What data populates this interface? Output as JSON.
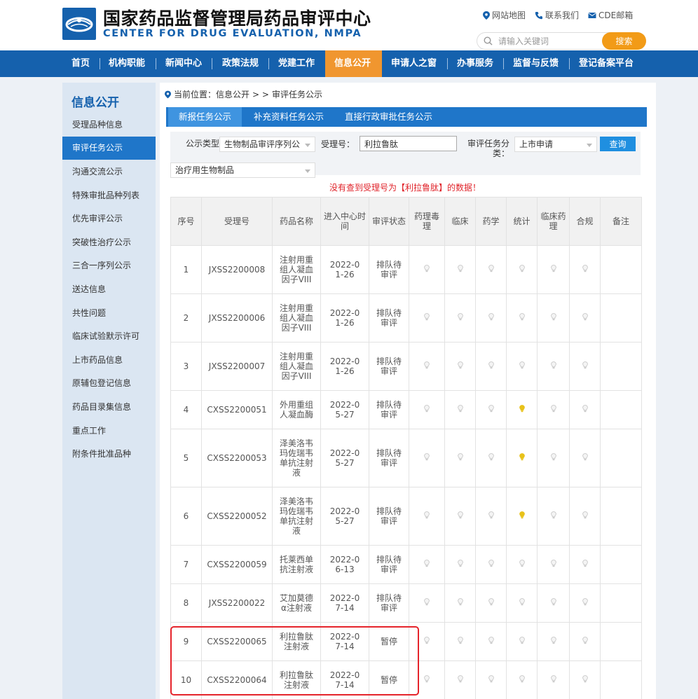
{
  "header": {
    "title_cn": "国家药品监督管理局药品审评中心",
    "title_en": "CENTER FOR DRUG EVALUATION, NMPA",
    "top_links": [
      "网站地图",
      "联系我们",
      "CDE邮箱"
    ],
    "search_placeholder": "请输入关键词",
    "search_button": "搜索"
  },
  "nav": {
    "items": [
      "首页",
      "机构职能",
      "新闻中心",
      "政策法规",
      "党建工作",
      "信息公开",
      "申请人之窗",
      "办事服务",
      "监督与反馈",
      "登记备案平台"
    ],
    "active": "信息公开"
  },
  "sidebar": {
    "title": "信息公开",
    "items": [
      "受理品种信息",
      "审评任务公示",
      "沟通交流公示",
      "特殊审批品种列表",
      "优先审评公示",
      "突破性治疗公示",
      "三合一序列公示",
      "送达信息",
      "共性问题",
      "临床试验默示许可",
      "上市药品信息",
      "原辅包登记信息",
      "药品目录集信息",
      "重点工作",
      "附条件批准品种"
    ],
    "active": "审评任务公示"
  },
  "breadcrumb": {
    "label": "当前位置：信息公开",
    "sep": "> >",
    "current": "审评任务公示"
  },
  "tabs": [
    "新报任务公示",
    "补充资料任务公示",
    "直接行政审批任务公示"
  ],
  "filter": {
    "type_label": "公示类型：",
    "type_value": "生物制品审评序列公",
    "acceptance_label": "受理号：",
    "acceptance_value": "利拉鲁肽",
    "category_label": "审评任务分类：",
    "category_value": "上市申请",
    "query_button": "查询",
    "subtype_value": "治疗用生物制品"
  },
  "notice": "没有查到受理号为【利拉鲁肽】的数据！",
  "table": {
    "headers": [
      "序号",
      "受理号",
      "药品名称",
      "进入中心时间",
      "审评状态",
      "药理毒理",
      "临床",
      "药学",
      "统计",
      "临床药理",
      "合规",
      "备注"
    ],
    "rows": [
      {
        "no": "1",
        "id": "JXSS2200008",
        "name": "注射用重组人凝血因子VIII",
        "date": "2022-01-26",
        "status": "排队待审评",
        "lit": [
          false,
          false,
          false,
          false,
          false,
          false
        ]
      },
      {
        "no": "2",
        "id": "JXSS2200006",
        "name": "注射用重组人凝血因子VIII",
        "date": "2022-01-26",
        "status": "排队待审评",
        "lit": [
          false,
          false,
          false,
          false,
          false,
          false
        ]
      },
      {
        "no": "3",
        "id": "JXSS2200007",
        "name": "注射用重组人凝血因子VIII",
        "date": "2022-01-26",
        "status": "排队待审评",
        "lit": [
          false,
          false,
          false,
          false,
          false,
          false
        ]
      },
      {
        "no": "4",
        "id": "CXSS2200051",
        "name": "外用重组人凝血酶",
        "date": "2022-05-27",
        "status": "排队待审评",
        "lit": [
          false,
          false,
          false,
          true,
          false,
          false
        ]
      },
      {
        "no": "5",
        "id": "CXSS2200053",
        "name": "泽美洛韦玛佐瑞韦单抗注射液",
        "date": "2022-05-27",
        "status": "排队待审评",
        "lit": [
          false,
          false,
          false,
          true,
          false,
          false
        ]
      },
      {
        "no": "6",
        "id": "CXSS2200052",
        "name": "泽美洛韦玛佐瑞韦单抗注射液",
        "date": "2022-05-27",
        "status": "排队待审评",
        "lit": [
          false,
          false,
          false,
          true,
          false,
          false
        ]
      },
      {
        "no": "7",
        "id": "CXSS2200059",
        "name": "托莱西单抗注射液",
        "date": "2022-06-13",
        "status": "排队待审评",
        "lit": [
          false,
          false,
          false,
          false,
          false,
          false
        ]
      },
      {
        "no": "8",
        "id": "JXSS2200022",
        "name": "艾加莫德α注射液",
        "date": "2022-07-14",
        "status": "排队待审评",
        "lit": [
          false,
          false,
          false,
          false,
          false,
          false
        ]
      },
      {
        "no": "9",
        "id": "CXSS2200065",
        "name": "利拉鲁肽注射液",
        "date": "2022-07-14",
        "status": "暂停",
        "lit": [
          false,
          false,
          false,
          false,
          false,
          false
        ]
      },
      {
        "no": "10",
        "id": "CXSS2200064",
        "name": "利拉鲁肽注射液",
        "date": "2022-07-14",
        "status": "暂停",
        "lit": [
          false,
          false,
          false,
          false,
          false,
          false
        ]
      }
    ]
  },
  "colors": {
    "brand_blue": "#1561ad",
    "nav_active": "#f0962f",
    "bulb_off": "#c8c8c8",
    "bulb_on": "#e8c21a",
    "highlight": "#e5242b"
  }
}
